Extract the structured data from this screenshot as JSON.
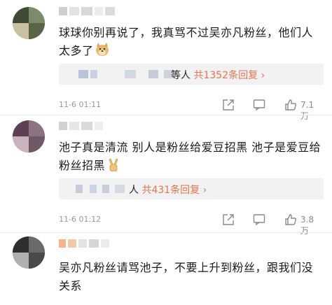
{
  "comments": [
    {
      "text": "球球你别再说了，我真骂不过吴亦凡粉丝，他们人太多了",
      "emoji": "doge-emoji",
      "reply_suffix": "等人",
      "reply_count": "共1352条回复",
      "reply_arrow": "›",
      "time": "11-6 01:11",
      "likes": "7.1万"
    },
    {
      "text": "池子真是清流 别人是粉丝给爱豆招黑 池子是爱豆给粉丝招黑",
      "emoji": "victory-hand-emoji",
      "reply_suffix": "人",
      "reply_count": "共431条回复",
      "reply_arrow": "›",
      "time": "11-6 01:12",
      "likes": "3.8万"
    },
    {
      "text": "吴亦凡粉丝请骂池子，不要上升到粉丝，跟我们没关系"
    }
  ],
  "colors": {
    "reply_link": "#eb7350",
    "meta_gray": "#999999",
    "reply_bg": "#f2f2f2"
  }
}
